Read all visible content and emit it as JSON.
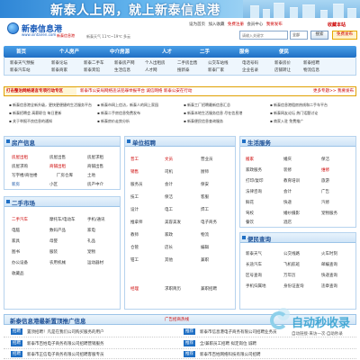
{
  "banner": {
    "slogan": "新泰人上网，就上新泰信息港"
  },
  "logo": {
    "name": "新泰信息港",
    "url": "www.xintairen.com",
    "subtitle": "新泰信息港"
  },
  "weather": "新泰天气 11℃~19℃ 多云",
  "toplinks": {
    "items": [
      "设为首页",
      "加入收藏",
      "免费注册",
      "会员中心",
      "我要发布"
    ],
    "fav": "收藏本站"
  },
  "search": {
    "placeholder": "请输入关键字",
    "category": "全部",
    "button": "搜索",
    "post": "免费发布"
  },
  "nav": {
    "main": [
      "首页",
      "个人房产",
      "中介房源",
      "人才",
      "二手",
      "服务",
      "便民"
    ],
    "sub": [
      [
        "新泰天气预报",
        "新泰论坛",
        "新泰二手车",
        "新泰房产网",
        "个人出租房",
        "二手房出售",
        "公交车站线",
        "电话号码",
        "新泰房价",
        "新泰招聘"
      ],
      [
        "新泰汽车站",
        "新泰商家",
        "新泰宾馆",
        "生活信息",
        "人才网",
        "搜新泰",
        "新泰厂家",
        "企业名录",
        "店铺转让",
        "物流信息"
      ]
    ]
  },
  "adbar": {
    "left": "打击整治网络谣言专项行动专区",
    "mid": "新泰市公安局网络违法犯罪举报平台 诚信网络 新泰公安在行动",
    "right": "更多专题>> 我要发布"
  },
  "notices": [
    "▪ 新泰信息港全新升级，更快更便捷的生活服务平台",
    "▪ 新泰市网上信访，新泰人的网上家园",
    "▪ 新泰工厂招聘最新信息汇总",
    "▪ 新泰信息港租房热线和二手车平台",
    "▪ 新泰招聘会 高薪职位 每日更新",
    "▪ 新泰二手房信息免费发布",
    "▪ 新泰本地生活服务信息 尽在信息港",
    "▪ 新泰网友论坛 热门话题讨论",
    "▪ 关于举报不良信息的通知",
    "▪ 新泰房价走势分析",
    "▪ 新泰便民信息查询服务",
    "▪ 商家入驻 免费推广"
  ],
  "house": {
    "title": "房产信息",
    "items": [
      "房屋出租",
      "房屋出售",
      "房屋求租",
      "房屋求购",
      "商铺出租",
      "商铺出售",
      "写字楼/商住楼",
      "厂房仓库",
      "土地",
      "新房",
      "小区",
      "房产中介"
    ]
  },
  "jobs": {
    "title": "单位招聘",
    "items": [
      "普工",
      "文员",
      "营业员",
      "销售",
      "司机",
      "厨师",
      "服务员",
      "会计",
      "保安",
      "技工",
      "保洁",
      "客服",
      "设计",
      "电工",
      "焊工",
      "推拿师",
      "美容美发",
      "电子商务",
      "教师",
      "家政",
      "物流",
      "仓管",
      "店长",
      "编辑",
      "钳工",
      "其他",
      "兼职",
      "经理",
      "求职简历",
      "兼职招聘"
    ]
  },
  "second": {
    "title": "二手市场",
    "items": [
      "二手汽车",
      "摩托车/电动车",
      "手机/通讯",
      "电脑",
      "数码产品",
      "家电",
      "家具",
      "母婴",
      "礼品",
      "图书",
      "服装",
      "宠物",
      "办公设备",
      "农用机械",
      "运动器材",
      "收藏品"
    ]
  },
  "life": {
    "title": "生活服务",
    "items": [
      "搬家",
      "婚庆",
      "保洁",
      "家政服务",
      "装修",
      "维修",
      "打印/复印",
      "教育培训",
      "旅游",
      "法律咨询",
      "会计",
      "广告",
      "鲜花",
      "快递",
      "汽修",
      "驾校",
      "婚纱摄影",
      "宠物服务",
      "餐饮",
      "酒店"
    ]
  },
  "convenience": {
    "title": "便民查询",
    "items": [
      "新泰天气",
      "公交线路",
      "火车时刻",
      "长途汽车",
      "飞机航班",
      "邮编查询",
      "区号查询",
      "万年历",
      "快递查询",
      "手机归属地",
      "身份证查询",
      "违章查询"
    ]
  },
  "bottom": {
    "title": "新泰信息港最新置顶推广信息",
    "right": "广告招商热线"
  },
  "bottomList": [
    {
      "tag": "招聘",
      "text": "置顶招聘！凡是在我们公司购买服务的用户"
    },
    {
      "tag": "招聘",
      "text": "新泰市百姓电子商务有限公司招聘营销服务"
    },
    {
      "tag": "招聘",
      "text": "新泰市正信电子商务有限公司招聘客服专员"
    }
  ],
  "bottomList2": [
    {
      "tag": "推荐",
      "text": "新泰市信息港电子商务有限公司招聘业务员"
    },
    {
      "tag": "推荐",
      "text": "全/兼职员工招聘 拟定岗位 诚聘"
    },
    {
      "tag": "推荐",
      "text": "新泰市百姓网络科技有限公司招聘"
    }
  ],
  "watermark": {
    "title": "自动秒收录",
    "sub": "自动链接·来访一次·自助秒录"
  }
}
